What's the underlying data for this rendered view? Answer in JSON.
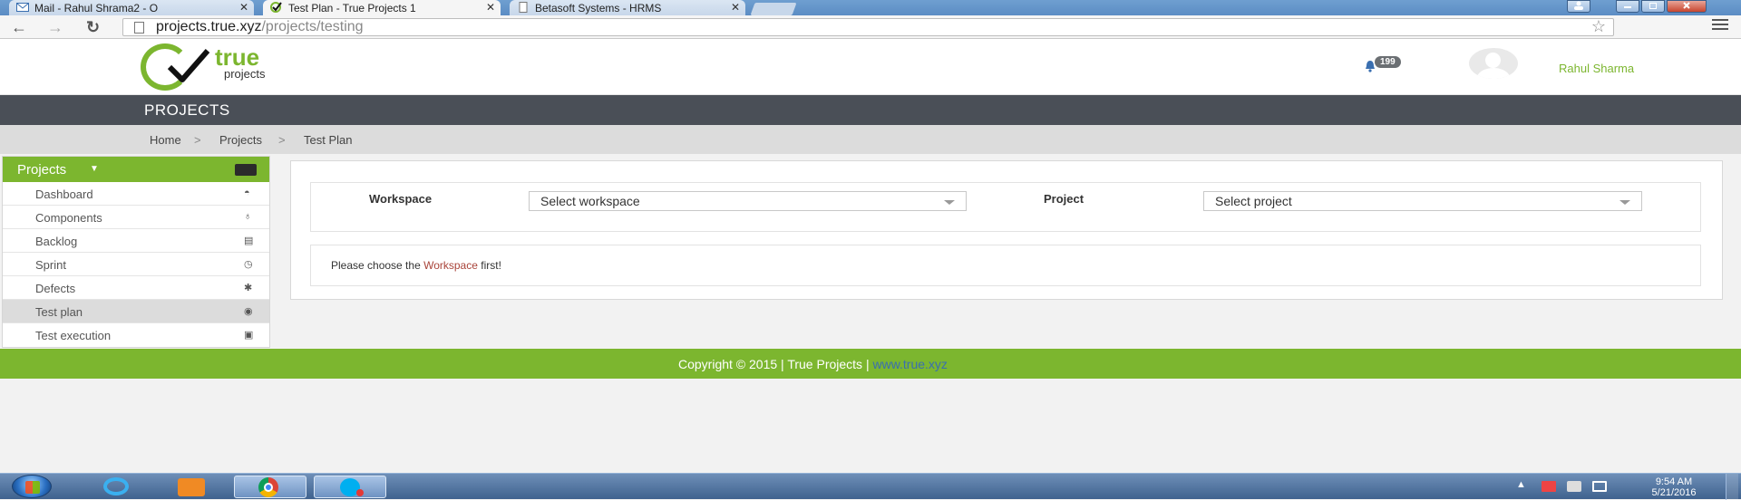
{
  "browser": {
    "tabs": [
      {
        "title": "Mail - Rahul Shrama2 - O",
        "icon": "mail-icon",
        "active": false
      },
      {
        "title": "Test Plan - True Projects 1",
        "icon": "check-icon",
        "active": true
      },
      {
        "title": "Betasoft Systems - HRMS",
        "icon": "page-icon",
        "active": false
      }
    ],
    "close_glyph": "✕",
    "url_host": "projects.true.xyz",
    "url_path": "/projects/testing",
    "back_glyph": "←",
    "forward_glyph": "→",
    "reload_glyph": "↻",
    "star_glyph": "☆"
  },
  "header": {
    "logo_main": "true",
    "logo_sub": "projects",
    "notification_count": "199",
    "user_name": "Rahul Sharma"
  },
  "section_title": "PROJECTS",
  "breadcrumb": [
    {
      "label": "Home"
    },
    {
      "label": "Projects"
    },
    {
      "label": "Test Plan"
    }
  ],
  "breadcrumb_sep": ">",
  "sidebar": {
    "heading": "Projects",
    "caret": "▼",
    "items": [
      {
        "label": "Dashboard",
        "icon": "dashboard-icon",
        "glyph": "◓",
        "active": false
      },
      {
        "label": "Components",
        "icon": "lightbulb-icon",
        "glyph": "♁",
        "active": false
      },
      {
        "label": "Backlog",
        "icon": "inbox-icon",
        "glyph": "▤",
        "active": false
      },
      {
        "label": "Sprint",
        "icon": "clock-icon",
        "glyph": "◷",
        "active": false
      },
      {
        "label": "Defects",
        "icon": "bug-icon",
        "glyph": "✱",
        "active": false
      },
      {
        "label": "Test plan",
        "icon": "eye-icon",
        "glyph": "◉",
        "active": true
      },
      {
        "label": "Test execution",
        "icon": "play-icon",
        "glyph": "▣",
        "active": false
      }
    ]
  },
  "filters": {
    "workspace_label": "Workspace",
    "workspace_value": "Select workspace",
    "project_label": "Project",
    "project_value": "Select project"
  },
  "message": {
    "before": "Please choose the",
    "highlight": "Workspace",
    "after": "first!"
  },
  "footer": {
    "text": "Copyright © 2015 | True Projects |",
    "link": "www.true.xyz"
  },
  "taskbar": {
    "time": "9:54 AM",
    "date": "5/21/2016",
    "tray_up_glyph": "▲"
  },
  "colors": {
    "brand_green": "#7cb62f",
    "dark_bar": "#4a4f57",
    "highlight_red": "#a9443a",
    "link_blue": "#3a6fb0"
  }
}
